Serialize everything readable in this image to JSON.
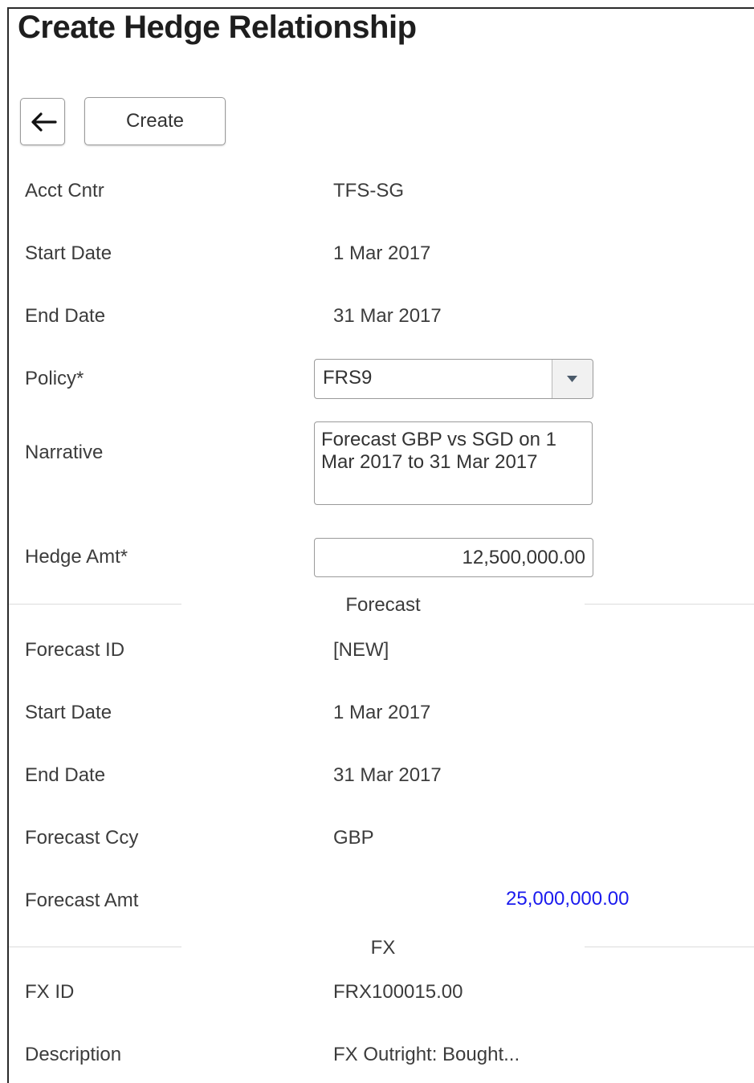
{
  "page_title": "Create Hedge Relationship",
  "toolbar": {
    "back_icon": "arrow-left-icon",
    "create_label": "Create"
  },
  "hedge": {
    "acct_cntr": {
      "label": "Acct Cntr",
      "value": "TFS-SG"
    },
    "start_date": {
      "label": "Start Date",
      "value": "1 Mar 2017"
    },
    "end_date": {
      "label": "End Date",
      "value": "31 Mar 2017"
    },
    "policy": {
      "label": "Policy*",
      "value": "FRS9",
      "dropdown_icon": "caret-down-icon"
    },
    "narrative": {
      "label": "Narrative",
      "value": "Forecast GBP vs SGD on 1 Mar 2017 to 31 Mar 2017"
    },
    "hedge_amt": {
      "label": "Hedge Amt*",
      "value": "12,500,000.00"
    }
  },
  "forecast": {
    "section_title": "Forecast",
    "forecast_id": {
      "label": "Forecast ID",
      "value": "[NEW]"
    },
    "start_date": {
      "label": "Start Date",
      "value": "1 Mar 2017"
    },
    "end_date": {
      "label": "End Date",
      "value": "31 Mar 2017"
    },
    "forecast_ccy": {
      "label": "Forecast Ccy",
      "value": "GBP"
    },
    "forecast_amt": {
      "label": "Forecast Amt",
      "value": "25,000,000.00"
    }
  },
  "fx": {
    "section_title": "FX",
    "fx_id": {
      "label": "FX ID",
      "value": "FRX100015.00"
    },
    "description": {
      "label": "Description",
      "value": "FX Outright: Bought..."
    }
  },
  "colors": {
    "link": "#1a1aee",
    "text": "#3c3c3c",
    "border": "#9a9a9a"
  }
}
